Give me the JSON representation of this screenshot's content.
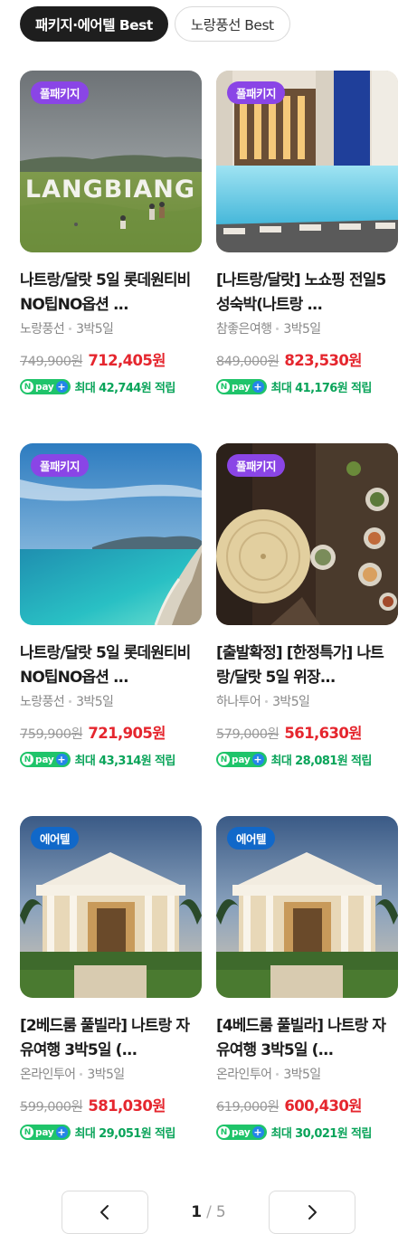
{
  "tabs": [
    {
      "label": "패키지·에어텔 Best",
      "active": true
    },
    {
      "label": "노랑풍선 Best",
      "active": false
    }
  ],
  "products": [
    {
      "badge": "풀패키지",
      "badge_type": "package",
      "image": "langbiang-hill-field",
      "image_text": "LANGBIANG",
      "title": "나트랑/달랏 5일 롯데원티비 NO팁NO옵션 ...",
      "seller": "노랑풍선",
      "duration": "3박5일",
      "original_price": "749,900원",
      "sale_price": "712,405원",
      "reward": "최대 42,744원 적립"
    },
    {
      "badge": "풀패키지",
      "badge_type": "package",
      "image": "resort-pool",
      "title": "[나트랑/달랏] 노쇼핑 전일5성숙박(나트랑 ...",
      "seller": "참좋은여행",
      "duration": "3박5일",
      "original_price": "849,000원",
      "sale_price": "823,530원",
      "reward": "최대 41,176원 적립"
    },
    {
      "badge": "풀패키지",
      "badge_type": "package",
      "image": "nhatrang-coast",
      "title": "나트랑/달랏 5일 롯데원티비 NO팁NO옵션 ...",
      "seller": "노랑풍선",
      "duration": "3박5일",
      "original_price": "759,900원",
      "sale_price": "721,905원",
      "reward": "최대 43,314원 적립"
    },
    {
      "badge": "풀패키지",
      "badge_type": "package",
      "image": "conical-hat-food",
      "title": "[출발확정] [한정특가] 나트랑/달랏 5일 위장...",
      "seller": "하나투어",
      "duration": "3박5일",
      "original_price": "579,000원",
      "sale_price": "561,630원",
      "reward": "최대 28,081원 적립"
    },
    {
      "badge": "에어텔",
      "badge_type": "airtel",
      "image": "villa-entrance",
      "title": "[2베드룸 풀빌라] 나트랑 자유여행 3박5일 (...",
      "seller": "온라인투어",
      "duration": "3박5일",
      "original_price": "599,000원",
      "sale_price": "581,030원",
      "reward": "최대 29,051원 적립"
    },
    {
      "badge": "에어텔",
      "badge_type": "airtel",
      "image": "villa-entrance",
      "title": "[4베드룸 풀빌라] 나트랑 자유여행 3박5일 (...",
      "seller": "온라인투어",
      "duration": "3박5일",
      "original_price": "619,000원",
      "sale_price": "600,430원",
      "reward": "최대 30,021원 적립"
    }
  ],
  "npay": {
    "n": "N",
    "pay": "pay",
    "plus": "+"
  },
  "pagination": {
    "current": "1",
    "separator": "/",
    "total": "5",
    "prev_icon": "chevron-left-icon",
    "next_icon": "chevron-right-icon"
  },
  "colors": {
    "package_badge": "#8a45e6",
    "airtel_badge": "#1168c9",
    "sale_price": "#e5262e",
    "reward": "#0aa45a",
    "npay": "#1fc46a"
  }
}
